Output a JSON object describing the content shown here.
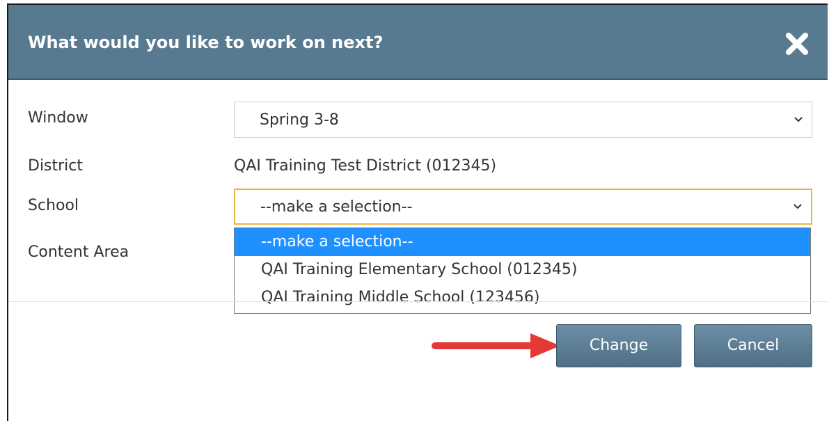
{
  "dialog": {
    "title": "What would you like to work on next?",
    "close_icon": "close-x-icon"
  },
  "form": {
    "window": {
      "label": "Window",
      "value": "Spring 3-8"
    },
    "district": {
      "label": "District",
      "value": "QAI Training Test District (012345)"
    },
    "school": {
      "label": "School",
      "value": "--make a selection--",
      "options": [
        "--make a selection--",
        "QAI Training Elementary School (012345)",
        "QAI Training Middle School (123456)"
      ],
      "highlighted_option": "--make a selection--"
    },
    "content_area": {
      "label": "Content Area"
    }
  },
  "buttons": {
    "change": "Change",
    "cancel": "Cancel"
  },
  "annotation": {
    "icon": "red-arrow-icon",
    "color": "#e53935"
  },
  "colors": {
    "header": "#587a91",
    "button": "#5c7d95",
    "focus_border": "#e6b54a",
    "option_highlight": "#1e90ff"
  }
}
